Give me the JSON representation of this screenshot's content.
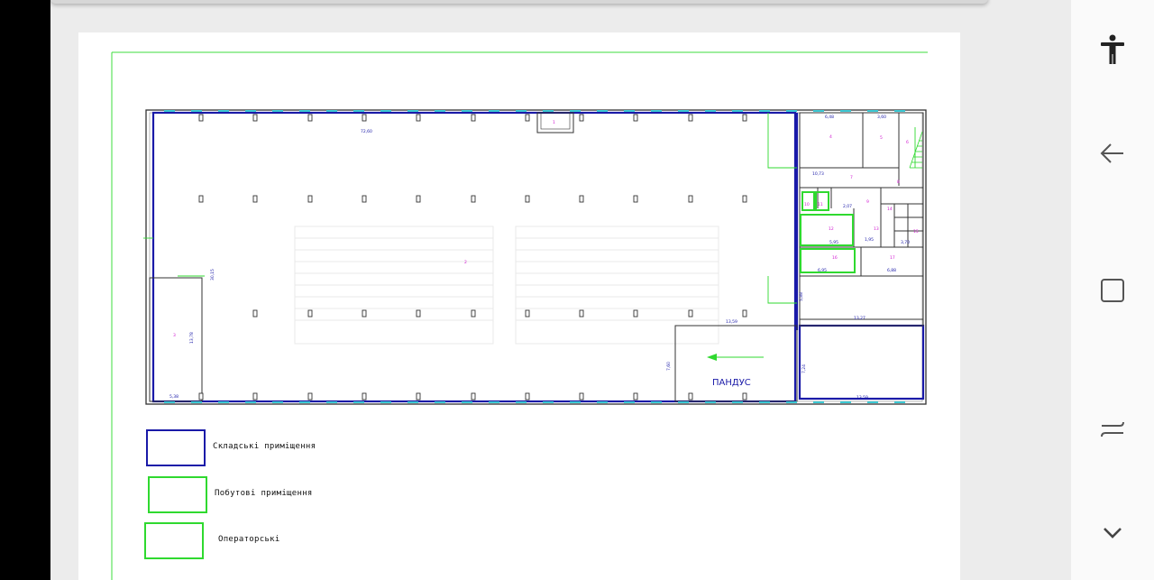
{
  "plan": {
    "ramp_label": "ПАНДУС",
    "dims": {
      "top_length": "72,60",
      "left_height": "30,15",
      "side_room_height": "13,78",
      "side_room_width": "5,38",
      "ramp_top": "13,59",
      "ramp_height": "7,60",
      "lower_room_height": "7,24",
      "lower_room_width": "13,59",
      "mid_room_width": "13,27",
      "mid_room_height": "5,88",
      "room_a": "6,48",
      "room_b": "3,60",
      "room_c": "10,73",
      "room_d": "2,07",
      "room_e": "5,95",
      "room_f": "6,95",
      "room_g": "6,88",
      "room_h": "3,70",
      "room_i": "1,95"
    },
    "room_tags": [
      "1",
      "2",
      "3",
      "4",
      "5",
      "6",
      "7",
      "8",
      "9",
      "10",
      "11",
      "12",
      "13",
      "14",
      "15",
      "16",
      "17"
    ]
  },
  "legend": [
    {
      "label": "Складські приміщення",
      "color": "#1a1aa8"
    },
    {
      "label": "Побутові приміщення",
      "color": "#2fd92f"
    },
    {
      "label": "Операторські",
      "color": "#2fd92f"
    }
  ],
  "nav": [
    {
      "icon": "accessibility-icon"
    },
    {
      "icon": "back-arrow-icon"
    },
    {
      "icon": "home-square-icon"
    },
    {
      "icon": "recent-apps-icon"
    },
    {
      "icon": "chevron-down-icon"
    }
  ]
}
